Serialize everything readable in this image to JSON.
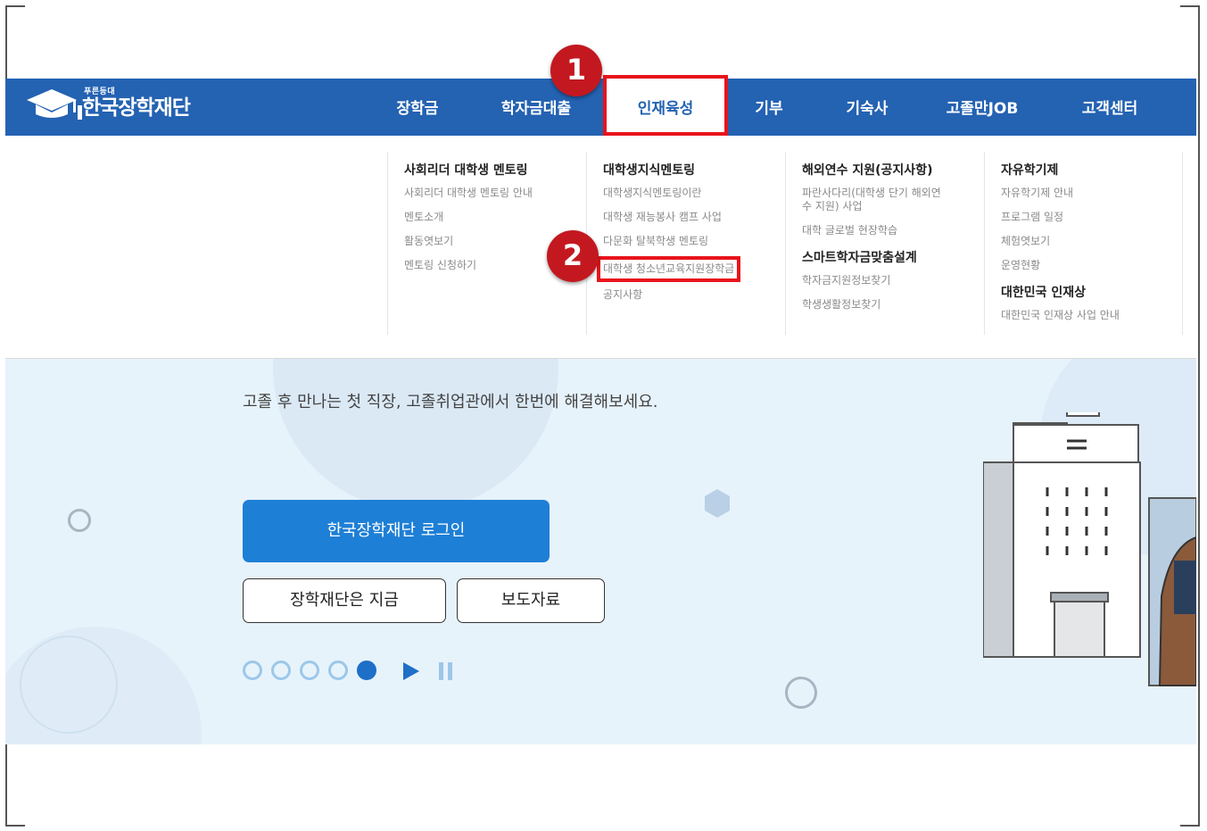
{
  "header": {
    "logo": {
      "tagline": "푸른등대",
      "name": "한국장학재단"
    },
    "nav": [
      {
        "label": "장학금"
      },
      {
        "label": "학자금대출"
      },
      {
        "label": "인재육성"
      },
      {
        "label": "기부"
      },
      {
        "label": "기숙사"
      },
      {
        "label": "고졸만JOB"
      },
      {
        "label": "고객센터"
      }
    ],
    "active_nav": "인재육성"
  },
  "menu": {
    "columns": [
      {
        "title": "사회리더 대학생 멘토링",
        "links": [
          "사회리더 대학생 멘토링 안내",
          "멘토소개",
          "활동엿보기",
          "멘토링 신청하기"
        ]
      },
      {
        "title": "대학생지식멘토링",
        "links": [
          "대학생지식멘토링이란",
          "대학생 재능봉사 캠프 사업",
          "다문화 탈북학생 멘토링",
          "대학생 청소년교육지원장학금",
          "공지사항"
        ]
      },
      {
        "title": "해외연수 지원(공지사항)",
        "links": [
          "파란사다리(대학생 단기 해외연수 지원) 사업",
          "대학 글로벌 현장학습"
        ],
        "title2": "스마트학자금맞춤설계",
        "links2": [
          "학자금지원정보찾기",
          "학생생활정보찾기"
        ]
      },
      {
        "title": "자유학기제",
        "links": [
          "자유학기제 안내",
          "프로그램 일정",
          "체험엿보기",
          "운영현황"
        ],
        "title2": "대한민국 인재상",
        "links2": [
          "대한민국 인재상 사업 안내"
        ]
      }
    ]
  },
  "banner": {
    "subtitle": "고졸 후 만나는 첫 직장, 고졸취업관에서 한번에 해결해보세요.",
    "login_label": "한국장학재단 로그인",
    "now_label": "장학재단은 지금",
    "press_label": "보도자료",
    "slides_total": 5,
    "slide_active": 5
  },
  "annotations": {
    "step1": "1",
    "step2": "2"
  },
  "colors": {
    "header_bg": "#2462b2",
    "highlight": "#e8141b",
    "badge": "#c41820",
    "login_button": "#1e7fd6",
    "banner_bg": "#e7f3fb"
  }
}
